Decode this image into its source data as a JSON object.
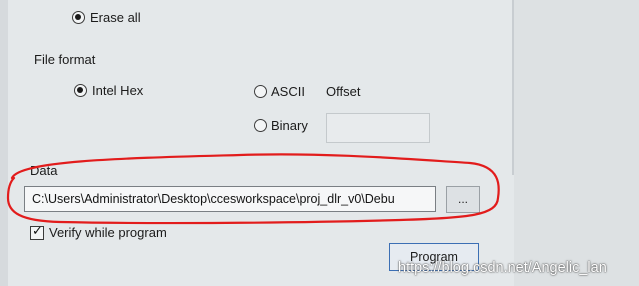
{
  "erase": {
    "label": "Erase all",
    "selected": true
  },
  "file_format": {
    "heading": "File format",
    "options": [
      {
        "label": "Intel Hex",
        "selected": true
      },
      {
        "label": "ASCII",
        "selected": false
      },
      {
        "label": "Binary",
        "selected": false
      }
    ],
    "offset_label": "Offset",
    "offset_value": ""
  },
  "data": {
    "heading": "Data",
    "path": "C:\\Users\\Administrator\\Desktop\\ccesworkspace\\proj_dlr_v0\\Debu",
    "browse_label": "..."
  },
  "verify": {
    "label": "Verify while program",
    "checked": true
  },
  "program_button": {
    "label": "Program"
  },
  "annotation": {
    "color": "#e21c1c"
  },
  "watermark": {
    "text": "https://blog.csdn.net/Angelic_lan"
  }
}
